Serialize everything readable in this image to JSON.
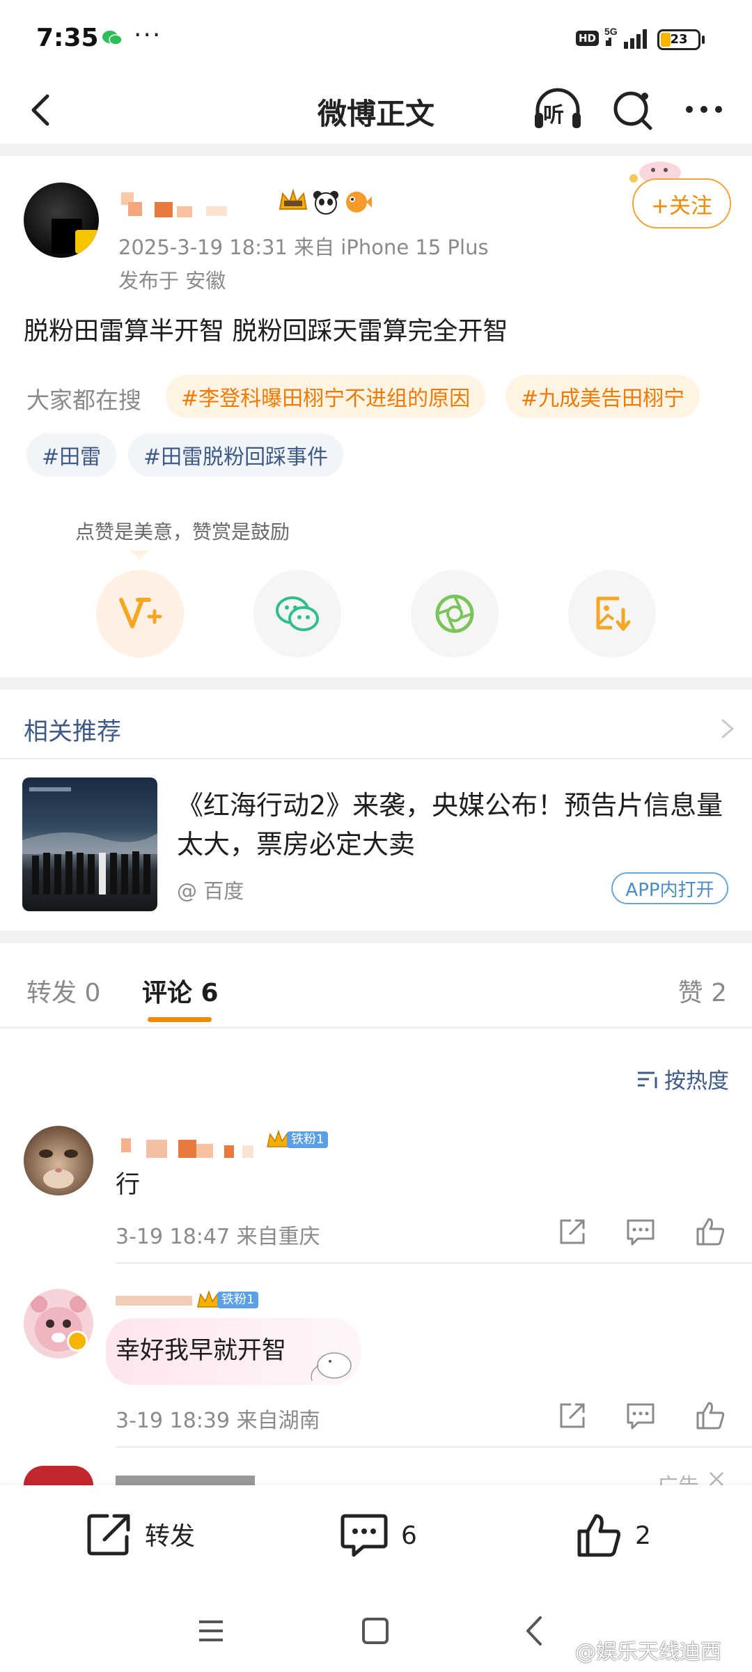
{
  "status_bar": {
    "time": "7:35",
    "dots": "···",
    "hd": "HD",
    "network": "5G",
    "battery": "23"
  },
  "nav": {
    "title": "微博正文",
    "listen_label": "听"
  },
  "post": {
    "meta": "2025-3-19 18:31  来自 iPhone 15 Plus",
    "location": "发布于 安徽",
    "follow_label": "+关注",
    "body": "脱粉田雷算半开智 脱粉回踩天雷算完全开智",
    "search_label": "大家都在搜",
    "tags": [
      "#李登科曝田栩宁不进组的原因",
      "#九成美告田栩宁",
      "#田雷",
      "#田雷脱粉回踩事件"
    ],
    "reward_text": "点赞是美意，赞赏是鼓励"
  },
  "related": {
    "title": "相关推荐",
    "headline": "《红海行动2》来袭，央媒公布！预告片信息量太大，票房必定大卖",
    "source": "@ 百度",
    "open_label": "APP内打开"
  },
  "tabs": {
    "repost": "转发 0",
    "comment": "评论 6",
    "like": "赞 2"
  },
  "sort_label": "按热度",
  "comments": [
    {
      "badge": "铁粉1",
      "text": "行",
      "meta": "3-19 18:47  来自重庆"
    },
    {
      "badge": "铁粉1",
      "text": "幸好我早就开智",
      "meta": "3-19 18:39  来自湖南"
    }
  ],
  "ad_label": "广告",
  "bottom_bar": {
    "repost_label": "转发",
    "comment_count": "6",
    "like_count": "2"
  },
  "watermark": "@娱乐天线迪西",
  "colors": {
    "accent_orange": "#f08a00",
    "link_blue": "#3e5a86",
    "fan_badge_blue": "#5b9fe6"
  }
}
